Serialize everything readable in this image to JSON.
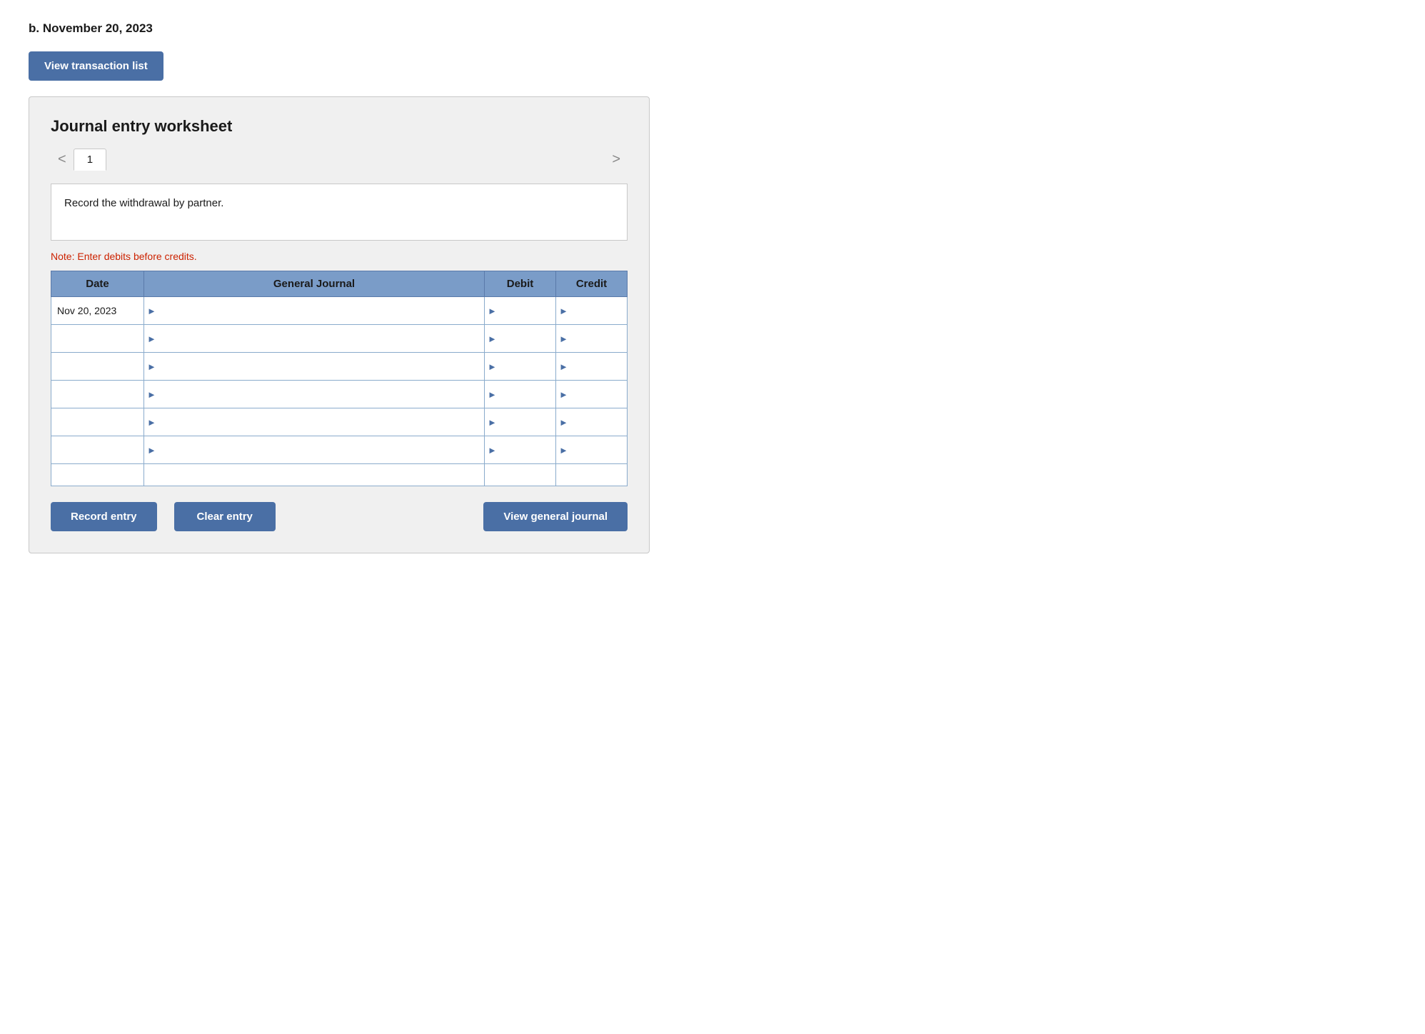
{
  "page": {
    "label": "b. November 20, 2023",
    "view_transaction_btn": "View transaction list"
  },
  "worksheet": {
    "title": "Journal entry worksheet",
    "tab_current": "1",
    "left_arrow": "<",
    "right_arrow": ">",
    "instruction": "Record the withdrawal by partner.",
    "note": "Note: Enter debits before credits.",
    "table": {
      "headers": {
        "date": "Date",
        "general_journal": "General Journal",
        "debit": "Debit",
        "credit": "Credit"
      },
      "rows": [
        {
          "date": "Nov 20, 2023",
          "journal": "",
          "debit": "",
          "credit": ""
        },
        {
          "date": "",
          "journal": "",
          "debit": "",
          "credit": ""
        },
        {
          "date": "",
          "journal": "",
          "debit": "",
          "credit": ""
        },
        {
          "date": "",
          "journal": "",
          "debit": "",
          "credit": ""
        },
        {
          "date": "",
          "journal": "",
          "debit": "",
          "credit": ""
        },
        {
          "date": "",
          "journal": "",
          "debit": "",
          "credit": ""
        },
        {
          "date": "",
          "journal": "",
          "debit": "",
          "credit": ""
        }
      ]
    },
    "btn_record": "Record entry",
    "btn_clear": "Clear entry",
    "btn_view_journal": "View general journal"
  }
}
